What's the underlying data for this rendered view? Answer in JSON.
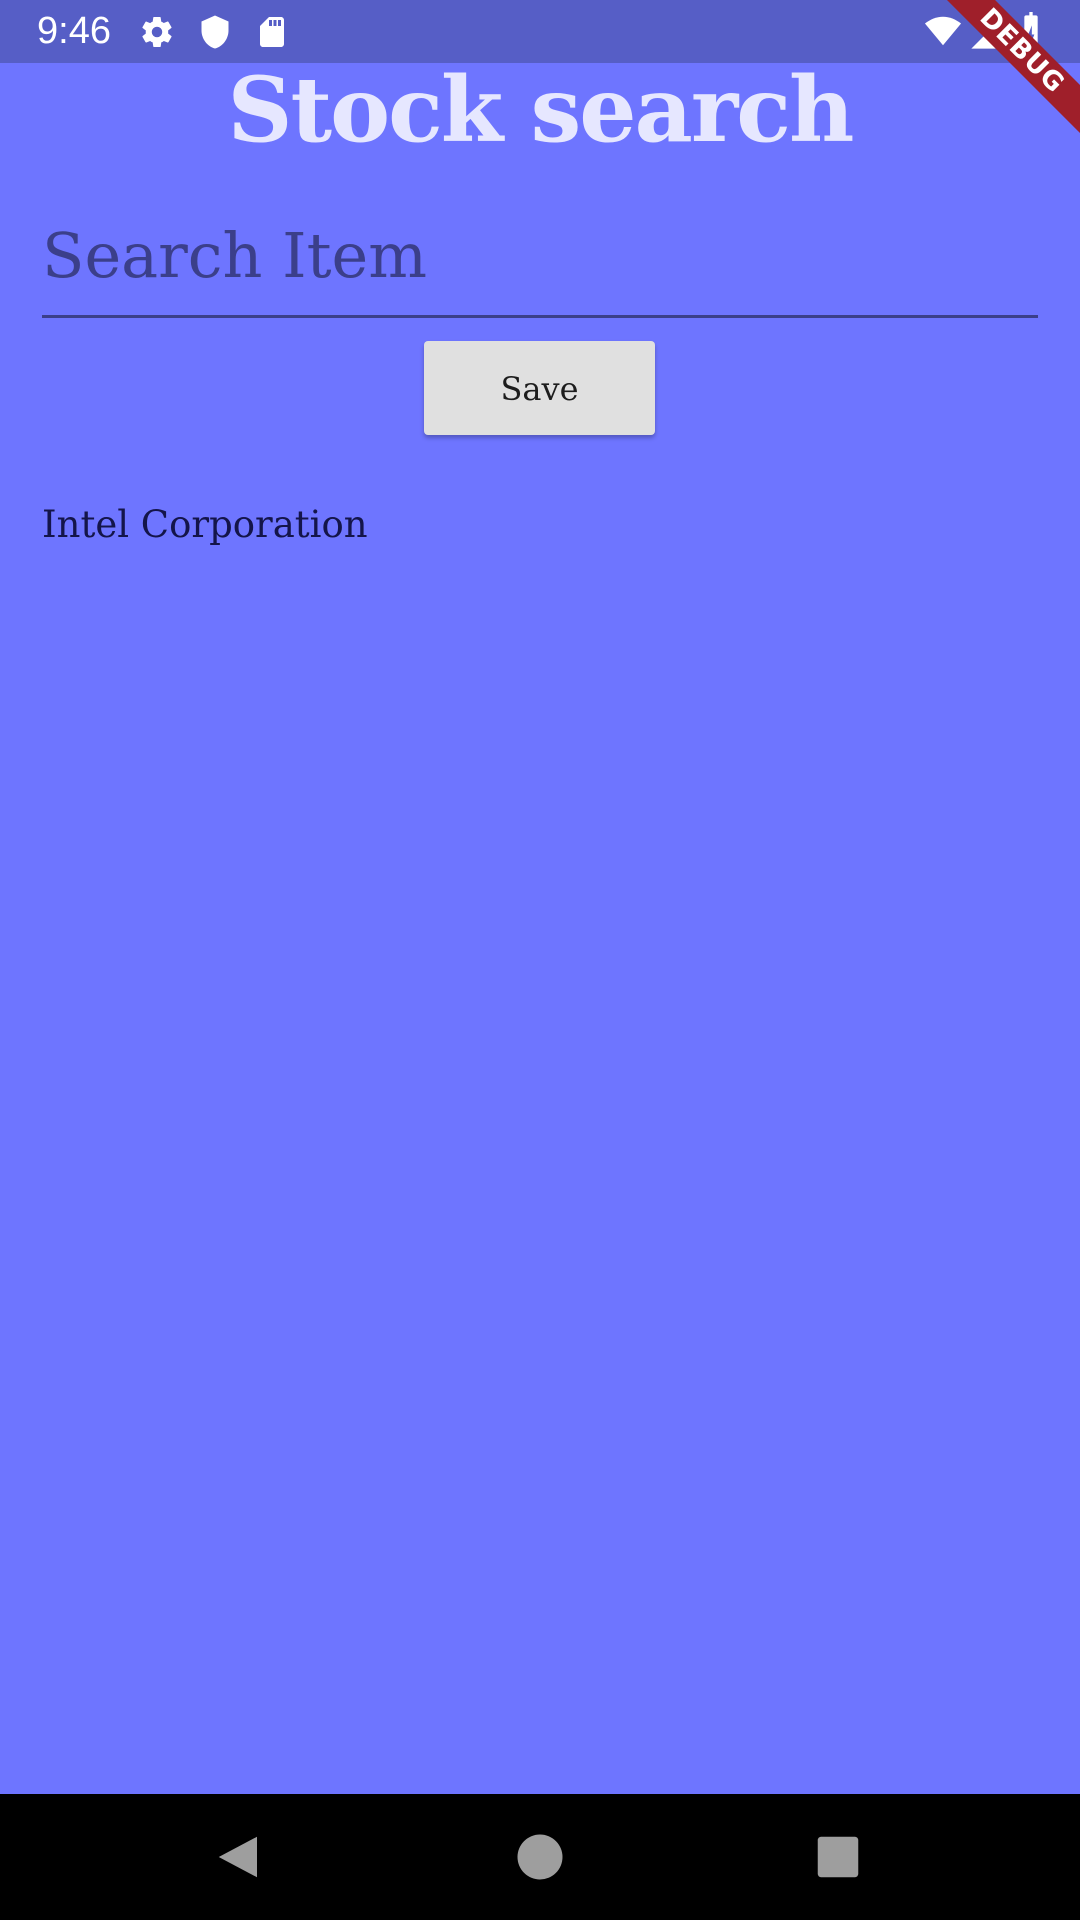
{
  "status_bar": {
    "time": "9:46",
    "left_icons": [
      "gear-icon",
      "shield-icon",
      "sd-card-icon"
    ],
    "right_icons": [
      "wifi-icon",
      "signal-icon",
      "battery-charging-icon"
    ],
    "color": "#565ec6"
  },
  "debug_banner": {
    "label": "DEBUG",
    "color": "#9f1f2a"
  },
  "header": {
    "title": "Stock search"
  },
  "search": {
    "placeholder": "Search Item",
    "value": ""
  },
  "actions": {
    "save_label": "Save"
  },
  "results": {
    "items": [
      {
        "label": "Intel Corporation"
      }
    ]
  },
  "nav_bar": {
    "buttons": [
      "back-icon",
      "home-icon",
      "recents-icon"
    ]
  },
  "theme": {
    "background": "#6e75ff",
    "title_color": "#e6e7ff",
    "input_color": "#3b3f8a"
  }
}
